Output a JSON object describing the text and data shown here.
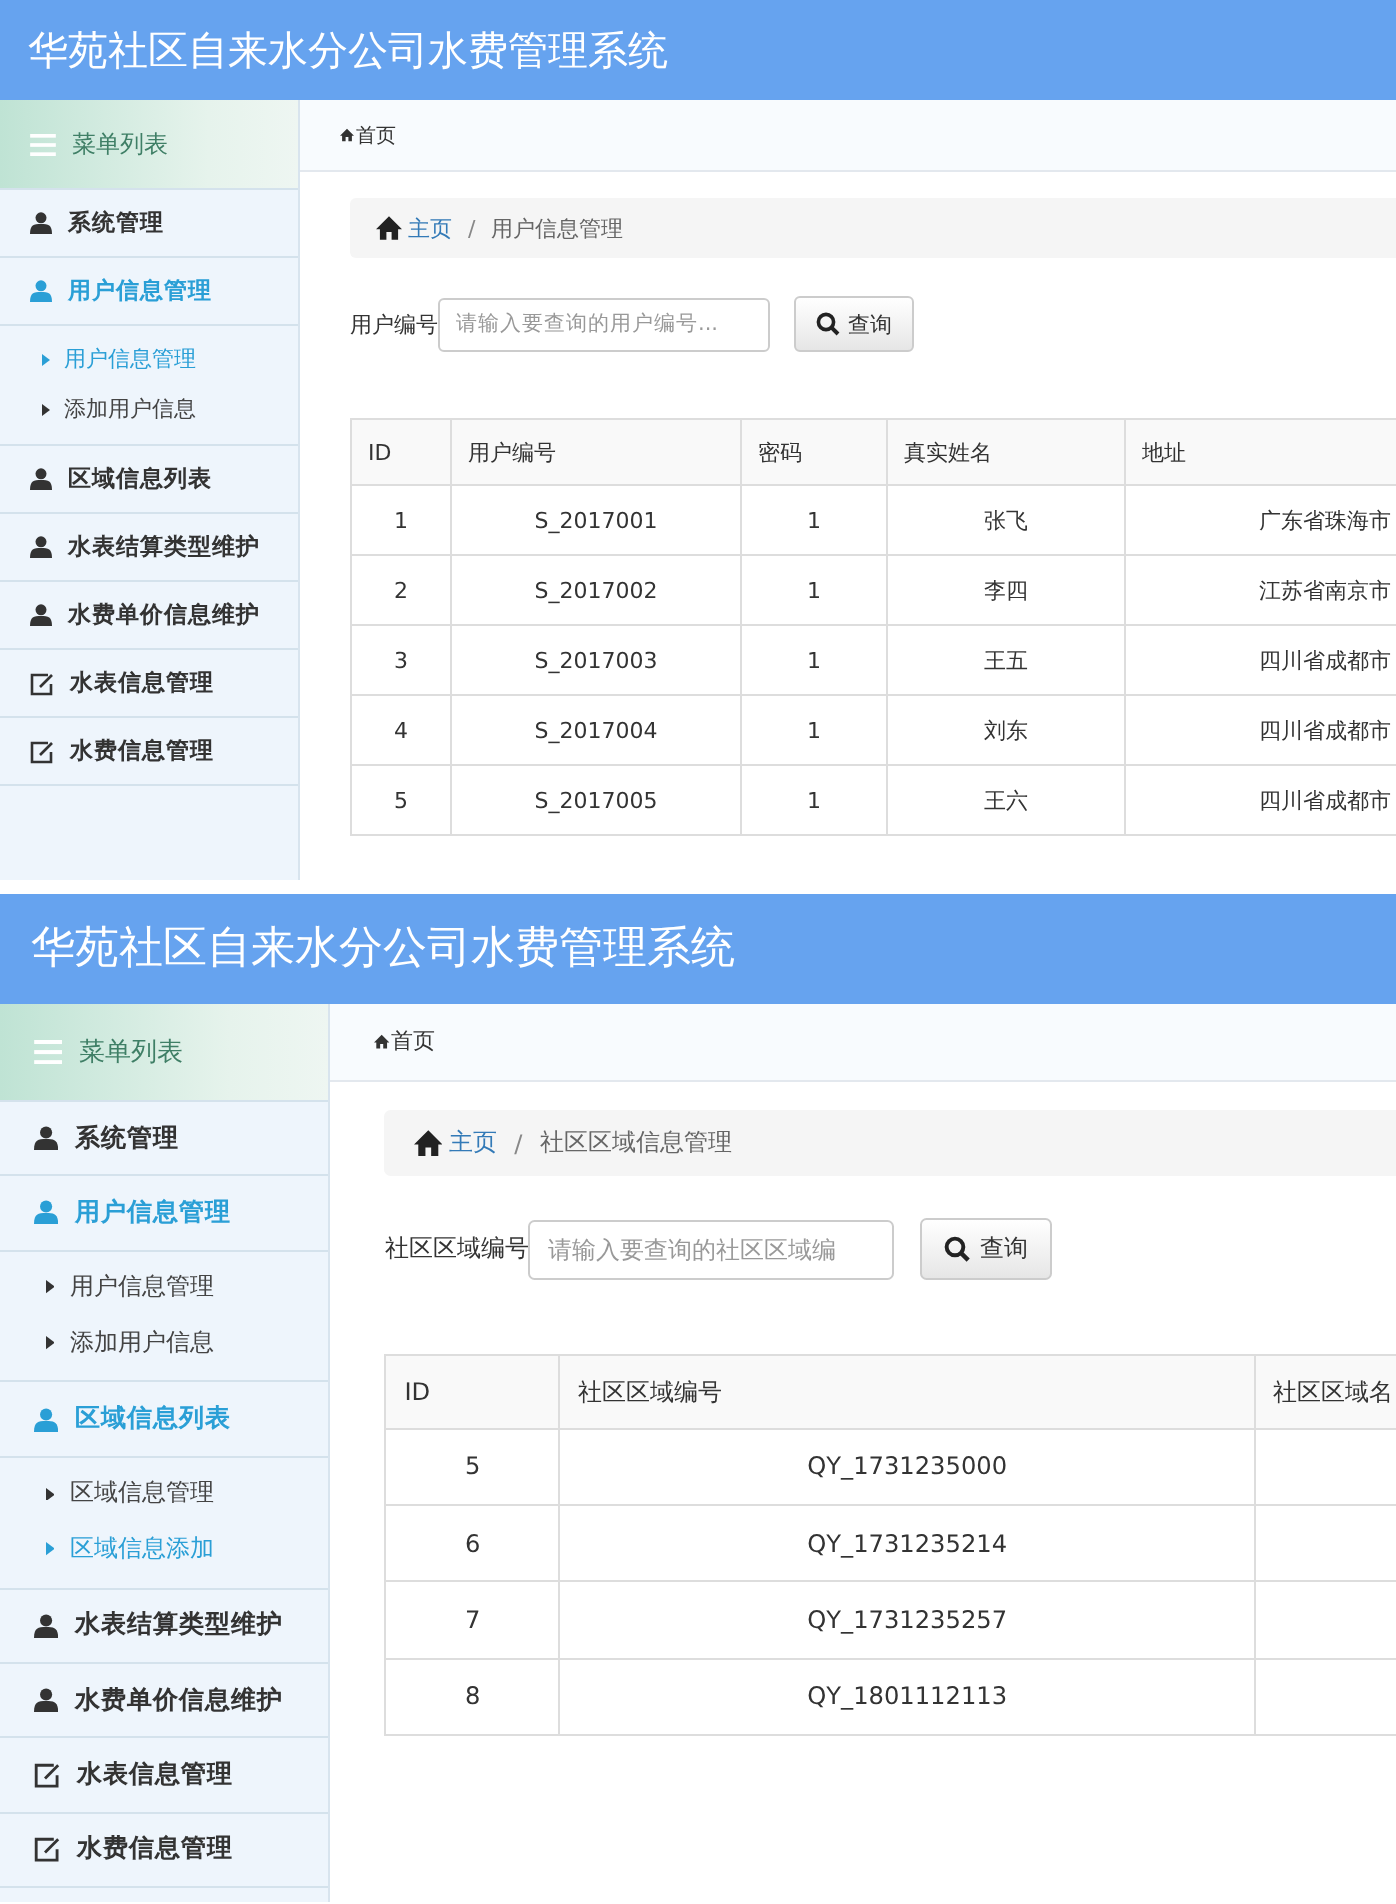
{
  "screens": [
    {
      "title": "华苑社区自来水分公司水费管理系统",
      "menu_title": "菜单列表",
      "menu": [
        {
          "label": "系统管理",
          "kind": "person",
          "selected": false
        },
        {
          "label": "用户信息管理",
          "kind": "person",
          "selected": true,
          "children": [
            {
              "label": "用户信息管理",
              "selected": true
            },
            {
              "label": "添加用户信息",
              "selected": false
            }
          ]
        },
        {
          "label": "区域信息列表",
          "kind": "person",
          "selected": false
        },
        {
          "label": "水表结算类型维护",
          "kind": "person",
          "selected": false
        },
        {
          "label": "水费单价信息维护",
          "kind": "person",
          "selected": false
        },
        {
          "label": "水表信息管理",
          "kind": "note",
          "selected": false
        },
        {
          "label": "水费信息管理",
          "kind": "note",
          "selected": false
        }
      ],
      "tab": "首页",
      "breadcrumb": {
        "home": "主页",
        "separator": "/",
        "current": "用户信息管理"
      },
      "search": {
        "label": "用户编号",
        "placeholder": "请输入要查询的用户编号...",
        "button": "查询"
      },
      "table": {
        "columns": [
          "ID",
          "用户编号",
          "密码",
          "真实姓名",
          "地址"
        ],
        "rows": [
          [
            "1",
            "S_2017001",
            "1",
            "张飞",
            "广东省珠海市"
          ],
          [
            "2",
            "S_2017002",
            "1",
            "李四",
            "江苏省南京市"
          ],
          [
            "3",
            "S_2017003",
            "1",
            "王五",
            "四川省成都市"
          ],
          [
            "4",
            "S_2017004",
            "1",
            "刘东",
            "四川省成都市"
          ],
          [
            "5",
            "S_2017005",
            "1",
            "王六",
            "四川省成都市"
          ]
        ]
      }
    },
    {
      "title": "华苑社区自来水分公司水费管理系统",
      "menu_title": "菜单列表",
      "menu": [
        {
          "label": "系统管理",
          "kind": "person",
          "selected": false
        },
        {
          "label": "用户信息管理",
          "kind": "person",
          "selected": true,
          "children": [
            {
              "label": "用户信息管理",
              "selected": false
            },
            {
              "label": "添加用户信息",
              "selected": false
            }
          ]
        },
        {
          "label": "区域信息列表",
          "kind": "person",
          "selected": true,
          "children": [
            {
              "label": "区域信息管理",
              "selected": false
            },
            {
              "label": "区域信息添加",
              "selected": true
            }
          ]
        },
        {
          "label": "水表结算类型维护",
          "kind": "person",
          "selected": false
        },
        {
          "label": "水费单价信息维护",
          "kind": "person",
          "selected": false
        },
        {
          "label": "水表信息管理",
          "kind": "note",
          "selected": false
        },
        {
          "label": "水费信息管理",
          "kind": "note",
          "selected": false
        }
      ],
      "tab": "首页",
      "breadcrumb": {
        "home": "主页",
        "separator": "/",
        "current": "社区区域信息管理"
      },
      "search": {
        "label": "社区区域编号",
        "placeholder": "请输入要查询的社区区域编",
        "button": "查询"
      },
      "table": {
        "columns": [
          "ID",
          "社区区域编号",
          "社区区域名"
        ],
        "rows": [
          [
            "5",
            "QY_1731235000"
          ],
          [
            "6",
            "QY_1731235214"
          ],
          [
            "7",
            "QY_1731235257"
          ],
          [
            "8",
            "QY_1801112113"
          ]
        ]
      }
    }
  ]
}
